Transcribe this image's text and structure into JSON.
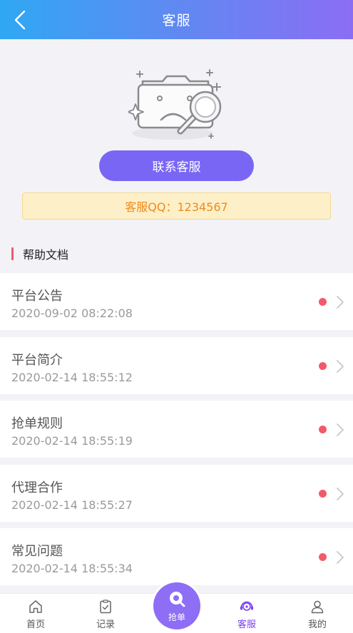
{
  "header": {
    "title": "客服",
    "back_icon": "chevron-left-icon"
  },
  "hero": {
    "illustration": "empty-folder-search-icon",
    "contact_button": "联系客服",
    "qq_text": "客服QQ：1234567"
  },
  "help": {
    "title": "帮助文档",
    "items": [
      {
        "name": "平台公告",
        "date": "2020-09-02 08:22:08"
      },
      {
        "name": "平台简介",
        "date": "2020-02-14 18:55:12"
      },
      {
        "name": "抢单规则",
        "date": "2020-02-14 18:55:19"
      },
      {
        "name": "代理合作",
        "date": "2020-02-14 18:55:27"
      },
      {
        "name": "常见问题",
        "date": "2020-02-14 18:55:34"
      }
    ]
  },
  "tabbar": {
    "home": "首页",
    "records": "记录",
    "grab": "抢单",
    "service": "客服",
    "mine": "我的"
  },
  "colors": {
    "accent": "#7a66f5",
    "unread_dot": "#f25a6c",
    "active_tab": "#7a3ff0",
    "qq_text": "#ef8a1e"
  }
}
